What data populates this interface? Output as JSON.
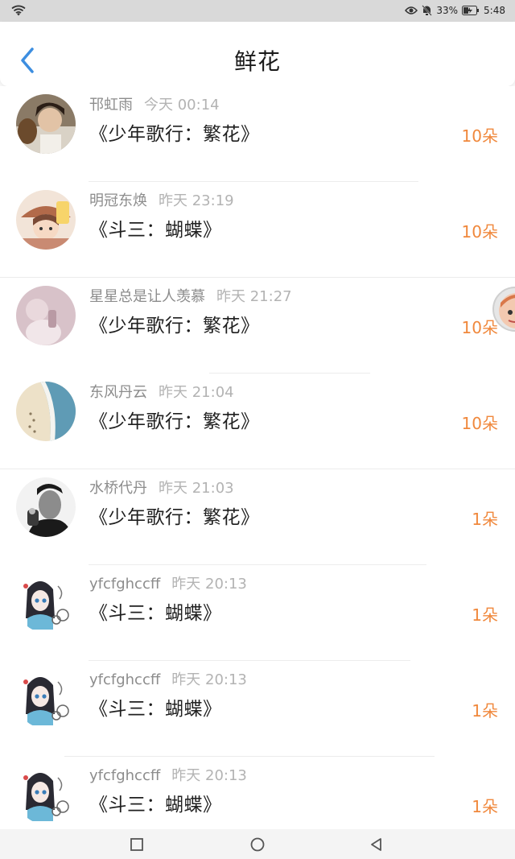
{
  "status_bar": {
    "battery": "33%",
    "time": "5:48"
  },
  "header": {
    "title": "鲜花"
  },
  "items": [
    {
      "name": "邗虹雨",
      "time": "今天 00:14",
      "gift": "《少年歌行：繁花》",
      "count": "10朵",
      "avatar": "portrait-avatar"
    },
    {
      "name": "明冠东焕",
      "time": "昨天 23:19",
      "gift": "《斗三：蝴蝶》",
      "count": "10朵",
      "avatar": "cartoon-avatar"
    },
    {
      "name": "星星总是让人羡慕",
      "time": "昨天 21:27",
      "gift": "《少年歌行：繁花》",
      "count": "10朵",
      "avatar": "pink-avatar"
    },
    {
      "name": "东风丹云",
      "time": "昨天 21:04",
      "gift": "《少年歌行：繁花》",
      "count": "10朵",
      "avatar": "beach-avatar"
    },
    {
      "name": "水桥代丹",
      "time": "昨天 21:03",
      "gift": "《少年歌行：繁花》",
      "count": "1朵",
      "avatar": "bw-portrait-avatar"
    },
    {
      "name": "yfcfghccff",
      "time": "昨天 20:13",
      "gift": "《斗三：蝴蝶》",
      "count": "1朵",
      "avatar": "anime-girl-avatar"
    },
    {
      "name": "yfcfghccff",
      "time": "昨天 20:13",
      "gift": "《斗三：蝴蝶》",
      "count": "1朵",
      "avatar": "anime-girl-avatar"
    },
    {
      "name": "yfcfghccff",
      "time": "昨天 20:13",
      "gift": "《斗三：蝴蝶》",
      "count": "1朵",
      "avatar": "anime-girl-avatar"
    }
  ],
  "colors": {
    "accent_blue": "#3d8ee0",
    "count_orange": "#f0883c"
  }
}
